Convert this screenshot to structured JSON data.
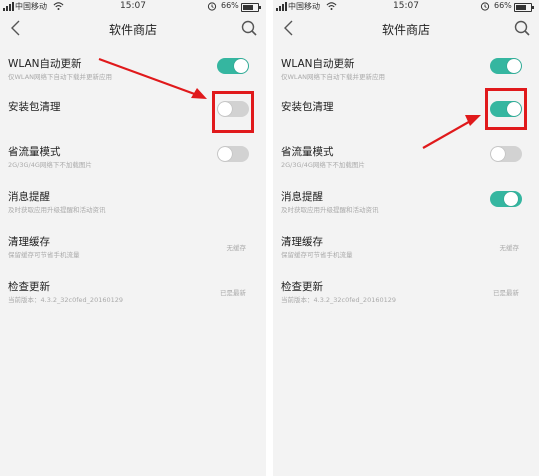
{
  "screens": [
    {
      "status": {
        "carrier": "中国移动",
        "time": "15:07",
        "battery": "66%"
      },
      "header": {
        "title": "软件商店",
        "back_icon": "back-icon",
        "search_icon": "search-icon"
      },
      "settings": [
        {
          "title": "WLAN自动更新",
          "desc": "仅WLAN网络下自动下载并更新应用",
          "toggle": "on"
        },
        {
          "title": "安装包清理",
          "desc": "",
          "toggle": "off"
        },
        {
          "title": "省流量模式",
          "desc": "2G/3G/4G网络下不加载图片",
          "toggle": "off"
        },
        {
          "title": "消息提醒",
          "desc": "及时获取应用升级提醒和活动资讯",
          "toggle": "none"
        },
        {
          "title": "清理缓存",
          "desc": "保留缓存可节省手机流量",
          "value": "无缓存"
        },
        {
          "title": "检查更新",
          "desc": "当前版本：4.3.2_32c0fed_20160129",
          "value": "已是最新"
        }
      ],
      "highlight_color": "#e0191b",
      "accent_color": "#35b6a0"
    },
    {
      "status": {
        "carrier": "中国移动",
        "time": "15:07",
        "battery": "66%"
      },
      "header": {
        "title": "软件商店",
        "back_icon": "back-icon",
        "search_icon": "search-icon"
      },
      "settings": [
        {
          "title": "WLAN自动更新",
          "desc": "仅WLAN网络下自动下载并更新应用",
          "toggle": "on"
        },
        {
          "title": "安装包清理",
          "desc": "",
          "toggle": "on"
        },
        {
          "title": "省流量模式",
          "desc": "2G/3G/4G网络下不加载图片",
          "toggle": "off"
        },
        {
          "title": "消息提醒",
          "desc": "及时获取应用升级提醒和活动资讯",
          "toggle": "mid"
        },
        {
          "title": "清理缓存",
          "desc": "保留缓存可节省手机流量",
          "value": "无缓存"
        },
        {
          "title": "检查更新",
          "desc": "当前版本：4.3.2_32c0fed_20160129",
          "value": "已是最新"
        }
      ],
      "highlight_color": "#e0191b",
      "accent_color": "#35b6a0"
    }
  ]
}
